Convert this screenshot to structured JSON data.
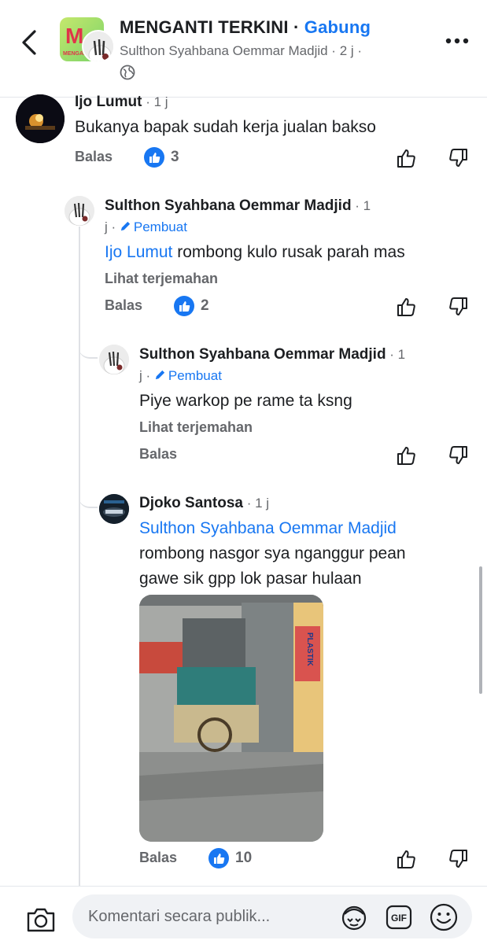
{
  "header": {
    "group_name": "MENGANTI TERKINI",
    "separator": " · ",
    "join_label": "Gabung",
    "poster_line": "Sulthon Syahbana Oemmar Madjid · 2 j ·",
    "group_logo_letter": "M",
    "group_logo_sub": "MENGANTI"
  },
  "comments": [
    {
      "author": "Ijo Lumut",
      "time": " · 1 j",
      "text": "Bukanya bapak sudah kerja jualan bakso",
      "reply_label": "Balas",
      "likes": "3"
    },
    {
      "author": "Sulthon Syahbana Oemmar Madjid",
      "time": " · 1",
      "time_cont": "j · ",
      "author_badge": "Pembuat",
      "mention": "Ijo Lumut",
      "text": " rombong kulo rusak parah mas",
      "translate_label": "Lihat terjemahan",
      "reply_label": "Balas",
      "likes": "2"
    },
    {
      "author": "Sulthon Syahbana Oemmar Madjid",
      "time": " · 1",
      "time_cont": "j · ",
      "author_badge": "Pembuat",
      "text": "Piye warkop pe rame ta ksng",
      "translate_label": "Lihat terjemahan",
      "reply_label": "Balas"
    },
    {
      "author": "Djoko Santosa",
      "time": " · 1 j",
      "mention": "Sulthon Syahbana Oemmar Madjid",
      "text_line1": "rombong nasgor sya nganggur pean",
      "text_line2": "gawe sik gpp lok pasar hulaan",
      "photo_sign": "PLASTIK",
      "reply_label": "Balas",
      "likes": "10"
    }
  ],
  "composer": {
    "placeholder": "Komentari secara publik..."
  },
  "icons": [
    "back-icon",
    "more-icon",
    "globe-icon",
    "like-icon",
    "thumbs-up-icon",
    "thumbs-down-icon",
    "pencil-icon",
    "camera-icon",
    "avatar-sticker-icon",
    "gif-icon",
    "emoji-icon"
  ],
  "colors": {
    "accent": "#1877f2",
    "secondary_text": "#65676b",
    "input_bg": "#f0f2f5"
  }
}
